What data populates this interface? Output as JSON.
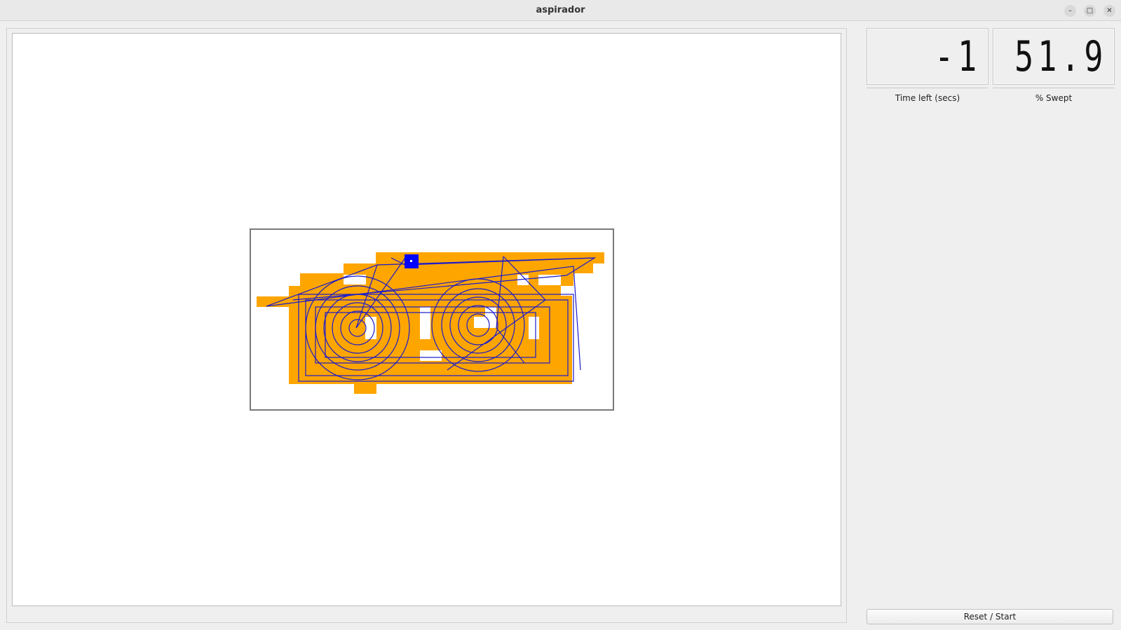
{
  "window": {
    "title": "aspirador",
    "minimize_label": "–",
    "maximize_label": "□",
    "close_label": "✕"
  },
  "displays": {
    "time_left": {
      "value": "-1",
      "label": "Time left (secs)"
    },
    "swept": {
      "value": "51.9",
      "label": "% Swept"
    }
  },
  "controls": {
    "reset_label": "Reset / Start"
  },
  "colors": {
    "swept_area": "#ffa500",
    "robot": "#0000ff",
    "path": "#1a1acc",
    "canvas": "#ffffff"
  }
}
